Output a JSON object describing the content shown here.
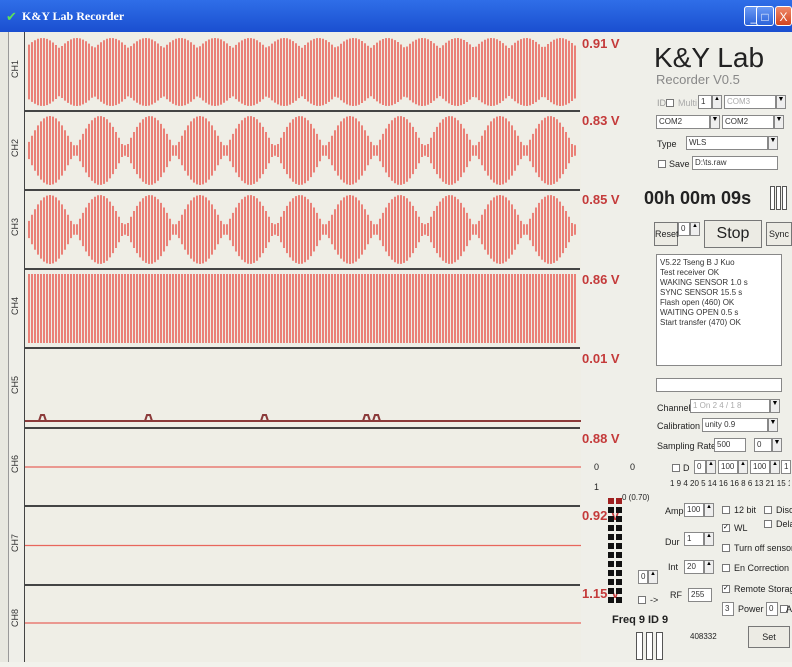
{
  "window": {
    "title": "K&Y Lab  Recorder",
    "logo_icon": "app-icon",
    "btn_min": "_",
    "btn_max": "□",
    "btn_close": "X"
  },
  "channels": [
    {
      "label": "CH1",
      "voltage": "0.91 V",
      "style": "dense"
    },
    {
      "label": "CH2",
      "voltage": "0.83 V",
      "style": "spindle"
    },
    {
      "label": "CH3",
      "voltage": "0.85 V",
      "style": "spindle"
    },
    {
      "label": "CH4",
      "voltage": "0.86 V",
      "style": "solid"
    },
    {
      "label": "CH5",
      "voltage": "0.01 V",
      "style": "flat-blips"
    },
    {
      "label": "CH6",
      "voltage": "0.88 V",
      "style": "flat"
    },
    {
      "label": "CH7",
      "voltage": "0.92 V",
      "style": "flat"
    },
    {
      "label": "CH8",
      "voltage": "1.15 V",
      "style": "flat"
    }
  ],
  "panel": {
    "title": "K&Y Lab",
    "subtitle": "Recorder V0.5",
    "id_label": "ID",
    "id_check_label": "Multi",
    "id_value": "1",
    "id_com": "COM3",
    "com_left": "COM2",
    "com_right": "COM2",
    "type_label": "Type",
    "type_value": "WLS",
    "save_label": "Save",
    "save_path": "D:\\ts.raw",
    "timer": "00h 00m 09s",
    "reset_label": "Reset",
    "reset_value": "0",
    "stop_label": "Stop",
    "sync_label": "Sync",
    "log": [
      "V5.22   Tseng B J Kuo",
      "Test receiver OK",
      "WAKING SENSOR 1.0 s",
      "SYNC SENSOR 15.5 s",
      "Flash open (460) OK",
      "WAITING OPEN 0.5 s",
      "Start transfer (470) OK"
    ],
    "channel_label": "Channel",
    "channel_value": "1 On 2 4 / 1 8",
    "calibration_label": "Calibration",
    "calibration_value": "unity 0.9",
    "sampling_label": "Sampling Rate",
    "sampling_value": "500",
    "sampling_unit": "0",
    "d_label": "D",
    "d_val1": "0",
    "d_val2": "100",
    "d_val3": "100",
    "d_val4": "1",
    "bits_row": "1 9 4 20 5 14 16 16 8 6 13 21 15 11",
    "leds_header": "0 (0.70)",
    "amp_label": "Amp",
    "amp_value": "100",
    "bit_label": "12 bit",
    "disc_label": "Disc",
    "wl_label": "WL",
    "dela_label": "Dela",
    "dur_label": "Dur",
    "dur_value": "1",
    "turnoff_label": "Turn off sensor",
    "int_label": "Int",
    "int_value": "20",
    "encorr_label": "En Correction",
    "small_value": "0",
    "remote_label": "Remote Storage",
    "arrow_label": "->",
    "rf_label": "RF",
    "rf_value": "255",
    "power_prefix": "3",
    "power_label": "Power",
    "power_value": "0",
    "a_label": "A",
    "freq_label": "Freq 9",
    "id9_label": "ID 9",
    "code_value": "408332",
    "set_label": "Set",
    "zero_a": "0",
    "zero_b": "0",
    "one_label": "1",
    "wave_color": "#e8665c"
  }
}
